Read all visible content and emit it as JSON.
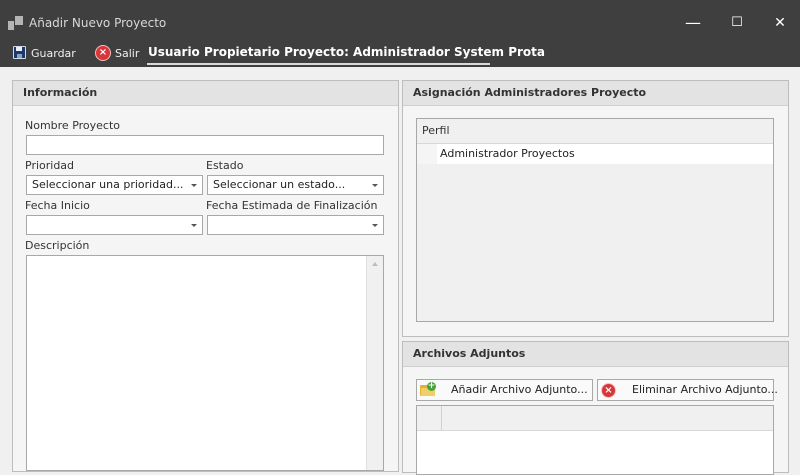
{
  "window": {
    "title": "Añadir Nuevo Proyecto",
    "controls": {
      "minimize": "—",
      "maximize": "☐",
      "close": "✕"
    }
  },
  "toolbar": {
    "save_label": "Guardar",
    "exit_label": "Salir",
    "owner_label": "Usuario Propietario Proyecto: Administrador System Prota"
  },
  "info_panel": {
    "header": "Información",
    "project_name_label": "Nombre Proyecto",
    "project_name_value": "",
    "priority_label": "Prioridad",
    "priority_value": "Seleccionar una prioridad...",
    "status_label": "Estado",
    "status_value": "Seleccionar un estado...",
    "start_date_label": "Fecha Inicio",
    "start_date_value": "",
    "end_date_label": "Fecha Estimada de Finalización",
    "end_date_value": "",
    "description_label": "Descripción",
    "description_value": ""
  },
  "admins_panel": {
    "header": "Asignación Administradores Proyecto",
    "column_header": "Perfil",
    "rows": [
      {
        "profile": "Administrador Proyectos"
      }
    ]
  },
  "attachments_panel": {
    "header": "Archivos Adjuntos",
    "add_label": "Añadir Archivo Adjunto...",
    "remove_label": "Eliminar Archivo Adjunto..."
  },
  "colors": {
    "titlebar": "#3f3f3f",
    "panel_header": "#e3e3e3",
    "delete_red": "#d6373a",
    "add_green": "#46a33d"
  }
}
